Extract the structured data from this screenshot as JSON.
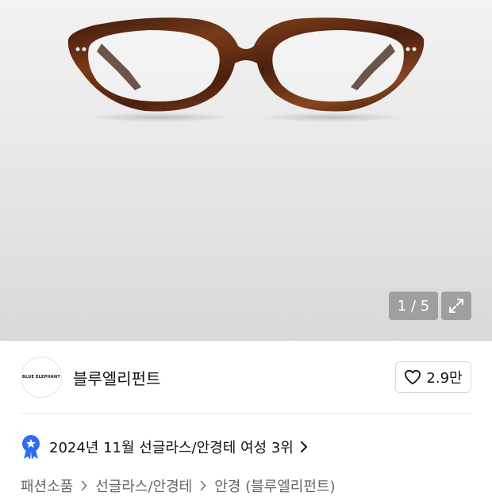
{
  "gallery": {
    "counter": "1 / 5"
  },
  "seller": {
    "logo_text": "BLUE ELEPHANT",
    "name": "블루엘리펀트",
    "likes": "2.9만"
  },
  "ranking": {
    "text": "2024년 11월 선글라스/안경테 여성 3위"
  },
  "breadcrumb": {
    "items": [
      "패션소품",
      "선글라스/안경테",
      "안경 (블루엘리펀트)"
    ]
  },
  "colors": {
    "badge_blue": "#2d6cf6",
    "frame_tortoise": "#5a2a14"
  }
}
